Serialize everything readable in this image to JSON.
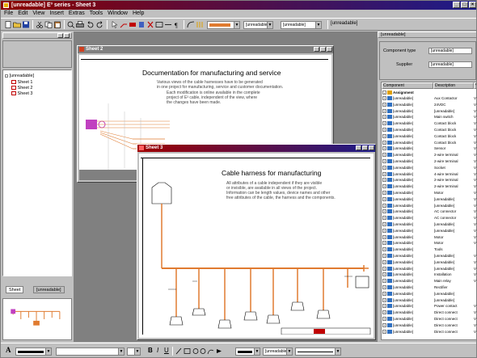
{
  "app": {
    "title": "[unreadable] E³ series - Sheet 3",
    "window_buttons": [
      "_",
      "□",
      "×"
    ]
  },
  "menu": [
    "File",
    "Edit",
    "View",
    "Insert",
    "Extras",
    "Tools",
    "Window",
    "Help"
  ],
  "toolbar": {
    "zoom_value": "[unreadable]",
    "text_value": "[unreadable]",
    "line_width_value": "[unreadable]"
  },
  "project_tree": {
    "root": "[unreadable]",
    "items": [
      "Sheet 1",
      "Sheet 2",
      "Sheet 3"
    ],
    "tabs": [
      "Sheet",
      "[unreadable]"
    ]
  },
  "sheet2": {
    "title": "Sheet 2",
    "heading": "Documentation for manufacturing and service",
    "paragraph": [
      "Various views of the cable harnesses have to be generated",
      "in one project for manufacturing, service and customer documentation.",
      "Each modification is online available in the complete",
      "project of E³ cable, independent of the view, where",
      "the changes have been made."
    ]
  },
  "sheet3": {
    "title": "Sheet 3",
    "heading": "Cable harness for manufacturing",
    "paragraph": [
      "All attributes of a cable independent if they are visible",
      "or invisible, are available in all views of the project.",
      "Information can be length values, device names and other",
      "free attributes of the cable, the harness and the components."
    ],
    "logo_text": "[unreadable]"
  },
  "right_panel": {
    "title": "[unreadable]",
    "component_type_label": "Component type",
    "component_type_value": "[unreadable]",
    "supplier_label": "Supplier",
    "supplier_value": "[unreadable]",
    "columns": [
      "Component",
      "Description",
      "V"
    ],
    "group": "Assignment",
    "rows": [
      {
        "c": "[unreadable]",
        "d": "Aux Contactor",
        "v": "V"
      },
      {
        "c": "[unreadable]",
        "d": "24VDC",
        "v": "V"
      },
      {
        "c": "[unreadable]",
        "d": "[unreadable]",
        "v": "V"
      },
      {
        "c": "[unreadable]",
        "d": "Main switch",
        "v": "V"
      },
      {
        "c": "[unreadable]",
        "d": "Contact block",
        "v": "V"
      },
      {
        "c": "[unreadable]",
        "d": "Contact block",
        "v": "V"
      },
      {
        "c": "[unreadable]",
        "d": "Contact block",
        "v": "V"
      },
      {
        "c": "[unreadable]",
        "d": "Contact block",
        "v": "V"
      },
      {
        "c": "[unreadable]",
        "d": "Sensor",
        "v": "V"
      },
      {
        "c": "[unreadable]",
        "d": "2-wire terminal",
        "v": "V"
      },
      {
        "c": "[unreadable]",
        "d": "2-wire terminal",
        "v": "V"
      },
      {
        "c": "[unreadable]",
        "d": "Socket",
        "v": "V"
      },
      {
        "c": "[unreadable]",
        "d": "4-wire terminal",
        "v": "V"
      },
      {
        "c": "[unreadable]",
        "d": "2-wire terminal",
        "v": "V"
      },
      {
        "c": "[unreadable]",
        "d": "2-wire terminal",
        "v": "V"
      },
      {
        "c": "[unreadable]",
        "d": "Motor",
        "v": "V"
      },
      {
        "c": "[unreadable]",
        "d": "[unreadable]",
        "v": "V"
      },
      {
        "c": "[unreadable]",
        "d": "[unreadable]",
        "v": "V"
      },
      {
        "c": "[unreadable]",
        "d": "AC connector",
        "v": "V"
      },
      {
        "c": "[unreadable]",
        "d": "AC connector",
        "v": "V"
      },
      {
        "c": "[unreadable]",
        "d": "[unreadable]",
        "v": "V"
      },
      {
        "c": "[unreadable]",
        "d": "[unreadable]",
        "v": "V"
      },
      {
        "c": "[unreadable]",
        "d": "Motor",
        "v": "V"
      },
      {
        "c": "[unreadable]",
        "d": "Motor",
        "v": "V"
      },
      {
        "c": "[unreadable]",
        "d": "Tools",
        "v": ""
      },
      {
        "c": "[unreadable]",
        "d": "[unreadable]",
        "v": "V"
      },
      {
        "c": "[unreadable]",
        "d": "[unreadable]",
        "v": "V"
      },
      {
        "c": "[unreadable]",
        "d": "[unreadable]",
        "v": "V"
      },
      {
        "c": "[unreadable]",
        "d": "Installation",
        "v": "V"
      },
      {
        "c": "[unreadable]",
        "d": "Main relay",
        "v": "V"
      },
      {
        "c": "[unreadable]",
        "d": "Rectifier",
        "v": ""
      },
      {
        "c": "[unreadable]",
        "d": "[unreadable]",
        "v": ""
      },
      {
        "c": "[unreadable]",
        "d": "[unreadable]",
        "v": ""
      },
      {
        "c": "[unreadable]",
        "d": "Power contact",
        "v": "V"
      },
      {
        "c": "[unreadable]",
        "d": "Direct connect",
        "v": "V"
      },
      {
        "c": "[unreadable]",
        "d": "Direct connect",
        "v": "V"
      },
      {
        "c": "[unreadable]",
        "d": "Direct connect",
        "v": "V"
      },
      {
        "c": "[unreadable]",
        "d": "Direct connect",
        "v": "V"
      }
    ]
  },
  "statusbar": {
    "font_label": "A",
    "bold": "B",
    "italic": "I",
    "underline": "U",
    "size_value": "[unreadable]"
  },
  "colors": {
    "titlebar_left": "#8b0000",
    "titlebar_right": "#1c1c8a",
    "wire": "#e07b30",
    "connector": "#c040c0"
  }
}
